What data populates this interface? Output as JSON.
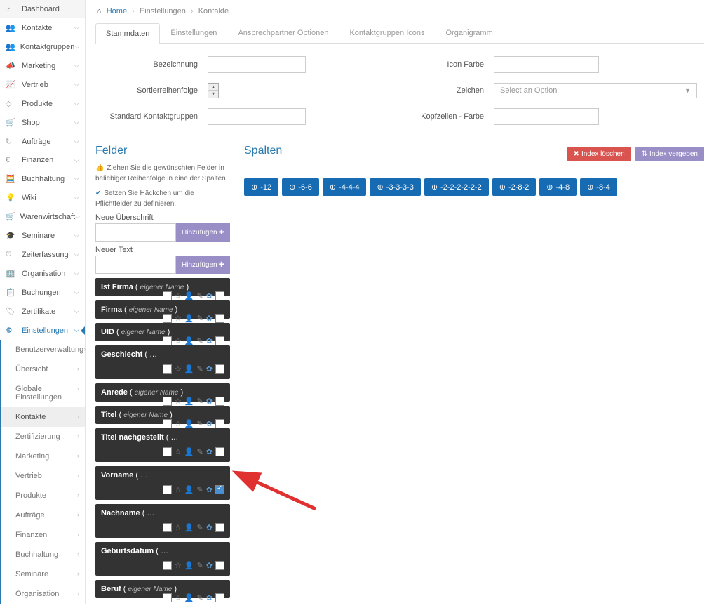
{
  "breadcrumb": {
    "home": "Home",
    "settings": "Einstellungen",
    "contacts": "Kontakte"
  },
  "sidebar": {
    "items": [
      {
        "icon": "◔",
        "label": "Dashboard",
        "chev": false
      },
      {
        "icon": "👥",
        "label": "Kontakte",
        "chev": true
      },
      {
        "icon": "👥",
        "label": "Kontaktgruppen",
        "chev": true
      },
      {
        "icon": "📣",
        "label": "Marketing",
        "chev": true
      },
      {
        "icon": "📈",
        "label": "Vertrieb",
        "chev": true
      },
      {
        "icon": "◇",
        "label": "Produkte",
        "chev": true
      },
      {
        "icon": "🛒",
        "label": "Shop",
        "chev": true
      },
      {
        "icon": "↻",
        "label": "Aufträge",
        "chev": true
      },
      {
        "icon": "€",
        "label": "Finanzen",
        "chev": true
      },
      {
        "icon": "🧮",
        "label": "Buchhaltung",
        "chev": true
      },
      {
        "icon": "💡",
        "label": "Wiki",
        "chev": true
      },
      {
        "icon": "🛒",
        "label": "Warenwirtschaft",
        "chev": true
      },
      {
        "icon": "🎓",
        "label": "Seminare",
        "chev": true
      },
      {
        "icon": "⏱",
        "label": "Zeiterfassung",
        "chev": true
      },
      {
        "icon": "🏢",
        "label": "Organisation",
        "chev": true
      },
      {
        "icon": "📋",
        "label": "Buchungen",
        "chev": true
      },
      {
        "icon": "🏷",
        "label": "Zertifikate",
        "chev": true
      },
      {
        "icon": "⚙",
        "label": "Einstellungen",
        "chev": true,
        "active": true
      }
    ],
    "sub": [
      {
        "label": "Benutzerverwaltung"
      },
      {
        "label": "Übersicht"
      },
      {
        "label": "Globale Einstellungen"
      },
      {
        "label": "Kontakte",
        "selected": true
      },
      {
        "label": "Zertifizierung"
      },
      {
        "label": "Marketing"
      },
      {
        "label": "Vertrieb"
      },
      {
        "label": "Produkte"
      },
      {
        "label": "Aufträge"
      },
      {
        "label": "Finanzen"
      },
      {
        "label": "Buchhaltung"
      },
      {
        "label": "Seminare"
      },
      {
        "label": "Organisation"
      }
    ]
  },
  "tabs": [
    "Stammdaten",
    "Einstellungen",
    "Ansprechpartner Optionen",
    "Kontaktgruppen Icons",
    "Organigramm"
  ],
  "form": {
    "bezeichnung": "Bezeichnung",
    "sortier": "Sortierreihenfolge",
    "standard": "Standard Kontaktgruppen",
    "iconfarbe": "Icon Farbe",
    "zeichen": "Zeichen",
    "kopfzeilen": "Kopfzeilen - Farbe",
    "select_placeholder": "Select an Option"
  },
  "felder": {
    "title": "Felder",
    "hint1": "Ziehen Sie die gewünschten Felder in beliebiger Reihenfolge in eine der Spalten.",
    "hint2": "Setzen Sie Häckchen um die Pflichtfelder zu definieren.",
    "neue_uber": "Neue Überschrift",
    "neuer_text": "Neuer Text",
    "add": "Hinzufügen",
    "items": [
      {
        "name": "Ist Firma",
        "hint": "eigener Name",
        "single": true
      },
      {
        "name": "Firma",
        "hint": "eigener Name",
        "single": true
      },
      {
        "name": "UID",
        "hint": "eigener Name",
        "single": true
      },
      {
        "name": "Geschlecht",
        "hint": "…",
        "single": false
      },
      {
        "name": "Anrede",
        "hint": "eigener Name",
        "single": true
      },
      {
        "name": "Titel",
        "hint": "eigener Name",
        "single": true
      },
      {
        "name": "Titel nachgestellt",
        "hint": "…",
        "single": false
      },
      {
        "name": "Vorname",
        "hint": "…",
        "single": false,
        "checked": true
      },
      {
        "name": "Nachname",
        "hint": "…",
        "single": false
      },
      {
        "name": "Geburtsdatum",
        "hint": "…",
        "single": false
      },
      {
        "name": "Beruf",
        "hint": "eigener Name",
        "single": true
      }
    ]
  },
  "spalten": {
    "title": "Spalten",
    "delete": "Index löschen",
    "reassign": "Index vergeben",
    "cols": [
      "-12",
      "-6-6",
      "-4-4-4",
      "-3-3-3-3",
      "-2-2-2-2-2-2",
      "-2-8-2",
      "-4-8",
      "-8-4"
    ]
  }
}
